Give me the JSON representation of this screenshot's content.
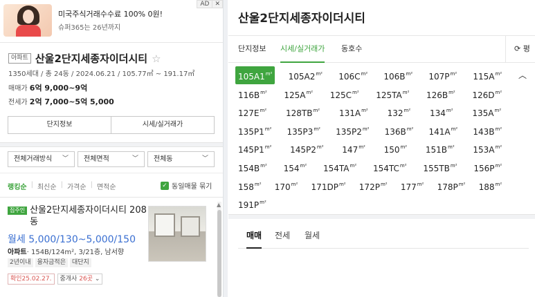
{
  "ad": {
    "title": "미국주식거래수수료 100% 0원!",
    "subtitle": "슈퍼365는 26년까지",
    "badge": "AD",
    "close": "✕"
  },
  "complex": {
    "type_tag": "아파트",
    "name": "산울2단지세종자이더시티",
    "favorite_icon": "☆",
    "meta": "1350세대 / 총 24동 / 2024.06.21 / 105.77㎡ ~ 191.17㎡",
    "sale_label": "매매가",
    "sale_value": "6억 9,000~9억",
    "jeonse_label": "전세가",
    "jeonse_value": "2억 7,000~5억 5,000",
    "tabs": [
      "단지정보",
      "시세/실거래가"
    ]
  },
  "filters": [
    "전체거래방식",
    "전체면적",
    "전체동"
  ],
  "sort": {
    "options": [
      "랭킹순",
      "최신순",
      "가격순",
      "면적순"
    ],
    "selected": "랭킹순",
    "same_listing_label": "동일매물 묶기",
    "same_listing_checked": true
  },
  "listing": {
    "owner_tag": "집주인",
    "name": "산울2단지세종자이더시티 208동",
    "price": "월세 5,000/130~5,000/150",
    "type": "아파트",
    "detail": "· 154B/124m², 3/21층, 남서향",
    "tags": [
      "2년이내",
      "융자금적은",
      "대단지"
    ],
    "confirmed": "확인25.02.27.",
    "agents_prefix": "중개사",
    "agents_count": "26곳",
    "agents_suffix": "⌄"
  },
  "right": {
    "title": "산울2단지세종자이더시티",
    "tabs": [
      "단지정보",
      "시세/실거래가",
      "동호수"
    ],
    "active_tab": "시세/실거래가",
    "refresh_label": "⟳ 평",
    "areas": [
      {
        "label": "105A1",
        "selected": true
      },
      {
        "label": "105A2",
        "selected": false
      },
      {
        "label": "106C",
        "selected": false
      },
      {
        "label": "106B",
        "selected": false
      },
      {
        "label": "107P",
        "selected": false
      },
      {
        "label": "115A",
        "selected": false
      },
      {
        "label": "116B",
        "selected": false
      },
      {
        "label": "125A",
        "selected": false
      },
      {
        "label": "125C",
        "selected": false
      },
      {
        "label": "125TA",
        "selected": false
      },
      {
        "label": "126B",
        "selected": false
      },
      {
        "label": "126D",
        "selected": false
      },
      {
        "label": "127E",
        "selected": false
      },
      {
        "label": "128TB",
        "selected": false
      },
      {
        "label": "131A",
        "selected": false
      },
      {
        "label": "132",
        "selected": false
      },
      {
        "label": "134",
        "selected": false
      },
      {
        "label": "135A",
        "selected": false
      },
      {
        "label": "135P1",
        "selected": false
      },
      {
        "label": "135P3",
        "selected": false
      },
      {
        "label": "135P2",
        "selected": false
      },
      {
        "label": "136B",
        "selected": false
      },
      {
        "label": "141A",
        "selected": false
      },
      {
        "label": "143B",
        "selected": false
      },
      {
        "label": "145P1",
        "selected": false
      },
      {
        "label": "145P2",
        "selected": false
      },
      {
        "label": "147",
        "selected": false
      },
      {
        "label": "150",
        "selected": false
      },
      {
        "label": "151B",
        "selected": false
      },
      {
        "label": "153A",
        "selected": false
      },
      {
        "label": "154B",
        "selected": false
      },
      {
        "label": "154",
        "selected": false
      },
      {
        "label": "154TA",
        "selected": false
      },
      {
        "label": "154TC",
        "selected": false
      },
      {
        "label": "155TB",
        "selected": false
      },
      {
        "label": "156P",
        "selected": false
      },
      {
        "label": "158",
        "selected": false
      },
      {
        "label": "170",
        "selected": false
      },
      {
        "label": "171DP",
        "selected": false
      },
      {
        "label": "172P",
        "selected": false
      },
      {
        "label": "177",
        "selected": false
      },
      {
        "label": "178P",
        "selected": false
      },
      {
        "label": "188",
        "selected": false
      },
      {
        "label": "191P",
        "selected": false
      }
    ],
    "area_unit": "m²",
    "collapse_icon": "^",
    "deal_tabs": [
      "매매",
      "전세",
      "월세"
    ],
    "active_deal": "매매"
  },
  "colors": {
    "accent": "#3fa53f",
    "price_blue": "#3a6fd1",
    "confirm_red": "#d9534f"
  }
}
